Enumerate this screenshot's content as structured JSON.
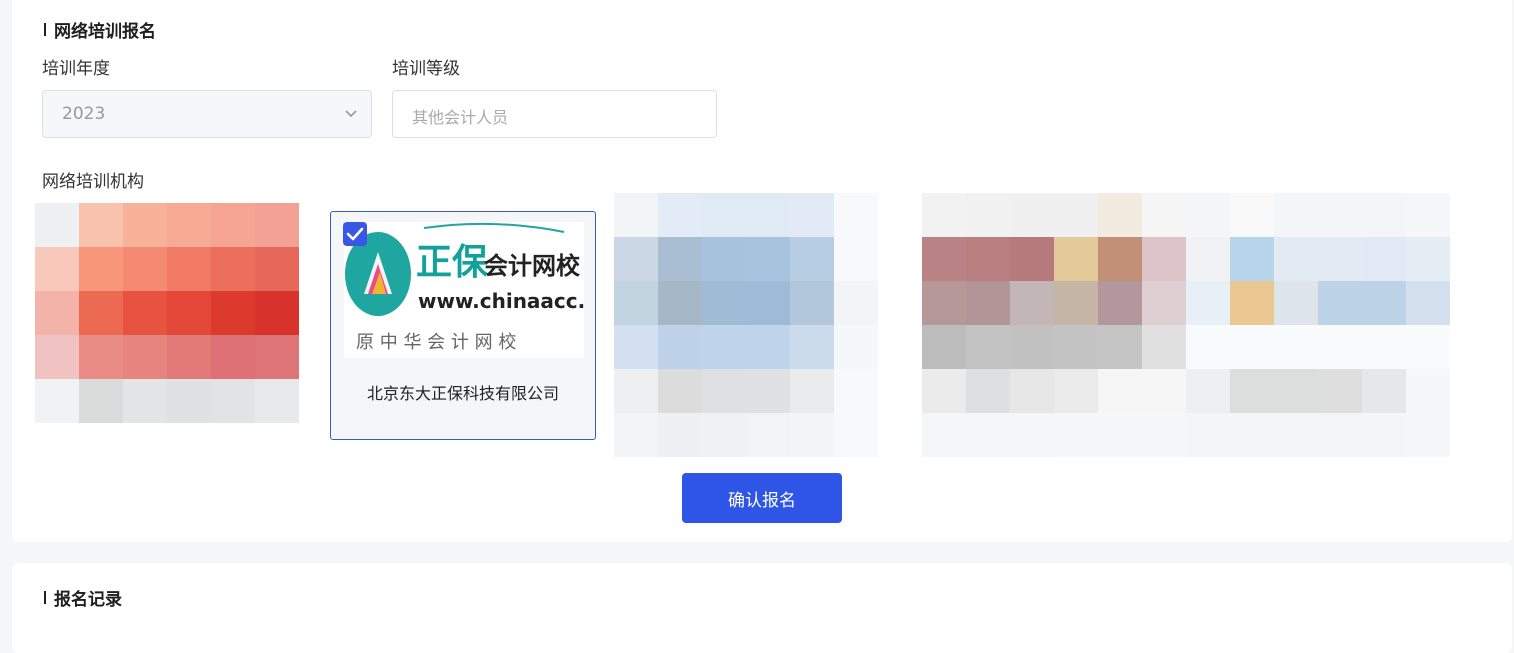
{
  "registration": {
    "title": "网络培训报名",
    "year_label": "培训年度",
    "year_value": "2023",
    "level_label": "培训等级",
    "level_placeholder": "其他会计人员",
    "org_label": "网络培训机构",
    "selected_org": {
      "name": "北京东大正保科技有限公司",
      "logo_text_main": "正保",
      "logo_text_side": "会计网校",
      "logo_url_text": "www.chinaacc.com",
      "logo_sub": "原 中 华 会 计 网 校"
    },
    "confirm_label": "确认报名"
  },
  "records": {
    "title": "报名记录"
  },
  "colors": {
    "accent": "#2e55e6",
    "checkbox": "#3a56e4",
    "selected_border": "#3c5bb5"
  }
}
